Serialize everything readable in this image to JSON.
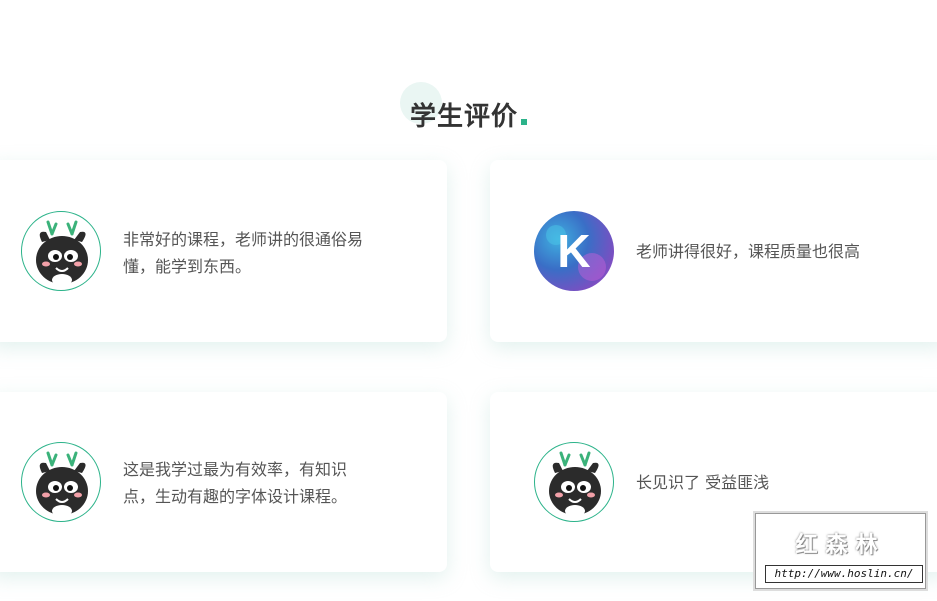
{
  "section": {
    "title": "学生评价",
    "accent_color": "#2cb38a"
  },
  "reviews": [
    {
      "avatar_icon": "dragon-mascot-avatar-icon",
      "text_line1": "非常好的课程，老师讲的很通俗易",
      "text_line2": "懂，能学到东西。"
    },
    {
      "avatar_icon": "k-letter-avatar-icon",
      "avatar_letter": "K",
      "text_line1": "老师讲得很好，课程质量也很高",
      "text_line2": ""
    },
    {
      "avatar_icon": "dragon-mascot-avatar-icon",
      "text_line1": "这是我学过最为有效率，有知识",
      "text_line2": "点，生动有趣的字体设计课程。"
    },
    {
      "avatar_icon": "dragon-mascot-avatar-icon",
      "text_line1": "长见识了 受益匪浅",
      "text_line2": ""
    }
  ],
  "watermark": {
    "logo_text": "红森林",
    "url": "http://www.hoslin.cn/"
  }
}
